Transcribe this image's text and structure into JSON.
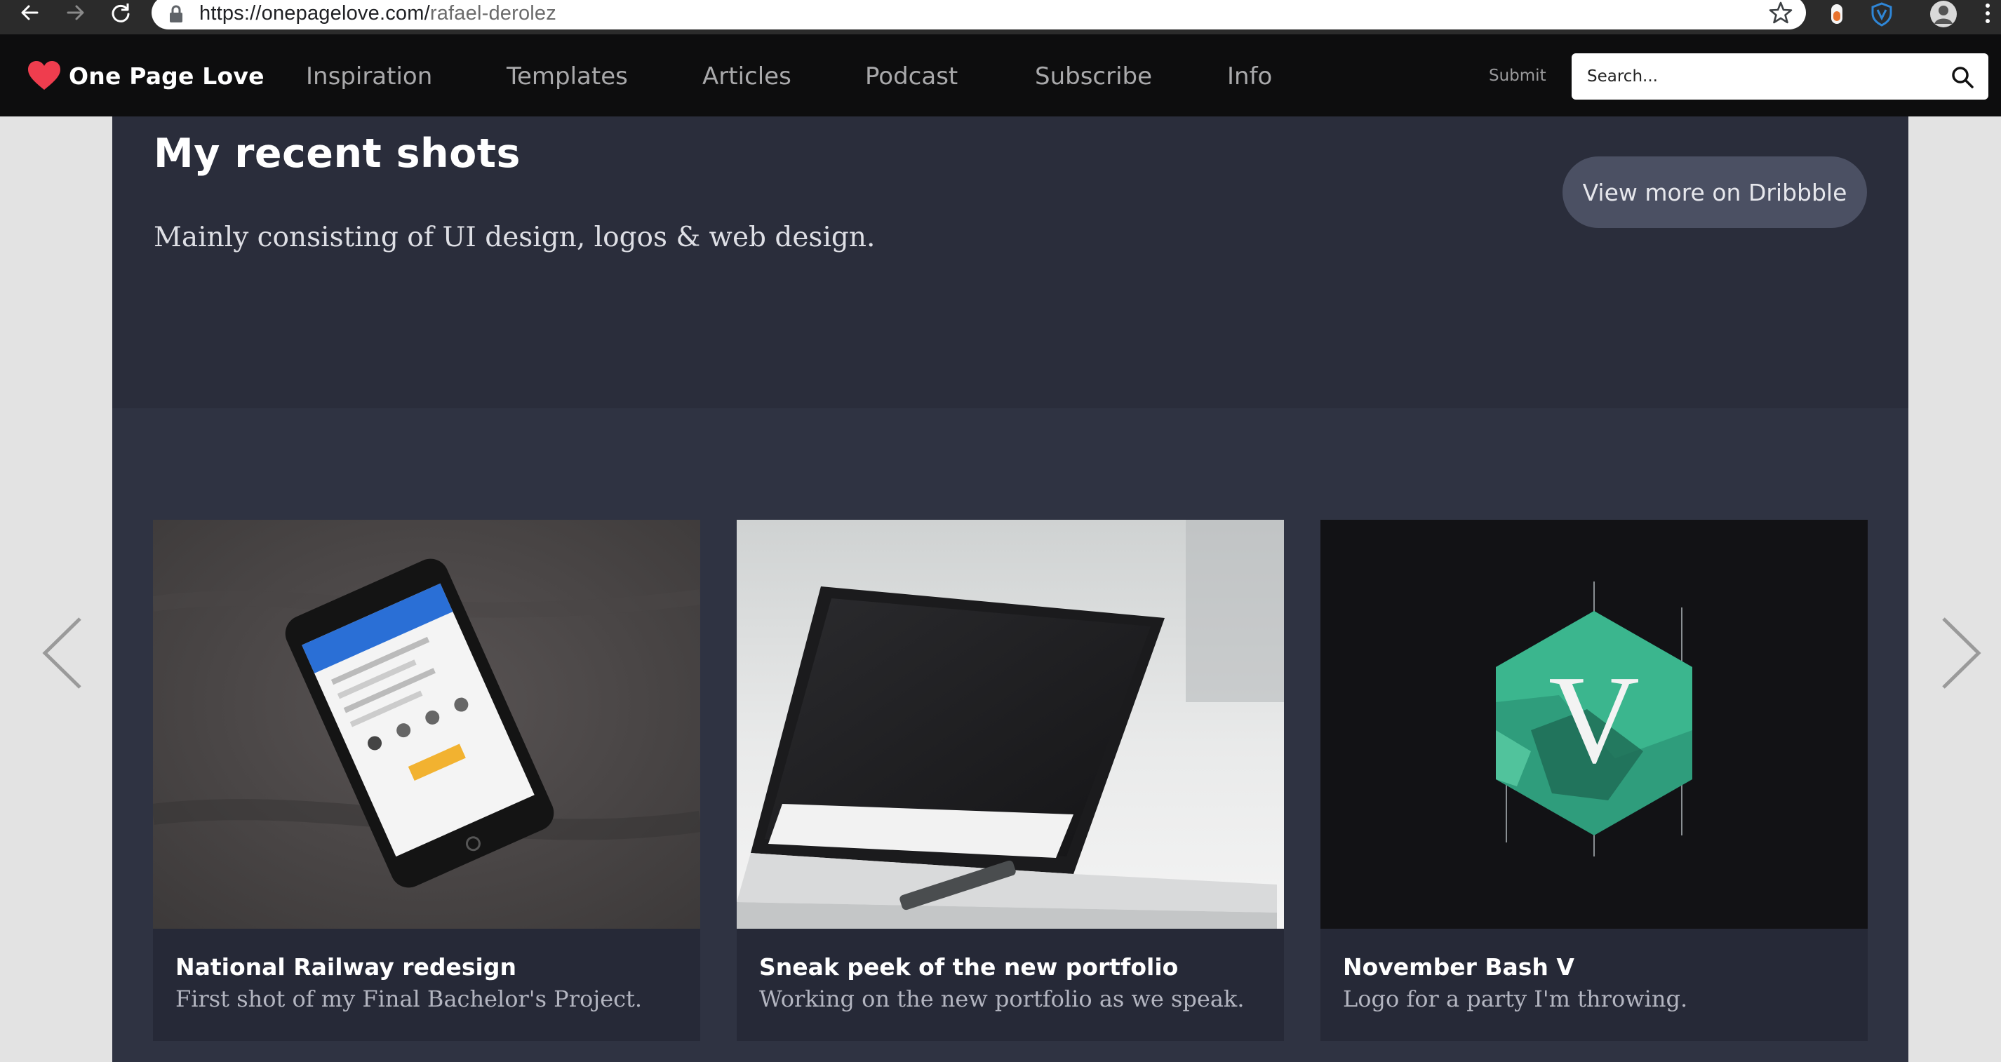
{
  "browser": {
    "url_host": "https://onepagelove.com/",
    "url_path": "rafael-derolez",
    "icons": [
      "back-arrow-icon",
      "forward-arrow-icon",
      "reload-icon",
      "lock-icon",
      "bookmark-star-icon",
      "extension-icon",
      "shield-extension-icon",
      "profile-avatar-icon",
      "menu-dots-icon"
    ]
  },
  "site": {
    "brand": "One Page Love",
    "brand_color": "#ef3d4e",
    "nav": [
      "Inspiration",
      "Templates",
      "Articles",
      "Podcast",
      "Subscribe",
      "Info"
    ],
    "submit_label": "Submit",
    "search_placeholder": "Search..."
  },
  "section": {
    "title": "My recent shots",
    "subtitle": "Mainly consisting of UI design, logos & web design.",
    "button_label": "View more on Dribbble"
  },
  "shots": [
    {
      "title": "National Railway redesign",
      "description": "First shot of my Final Bachelor's Project."
    },
    {
      "title": "Sneak peek of the new portfolio",
      "description": "Working on the new portfolio as we speak."
    },
    {
      "title": "November Bash V",
      "description": "Logo for a party I'm throwing."
    }
  ],
  "carousel": {
    "prev_icon": "chevron-left-icon",
    "next_icon": "chevron-right-icon"
  }
}
